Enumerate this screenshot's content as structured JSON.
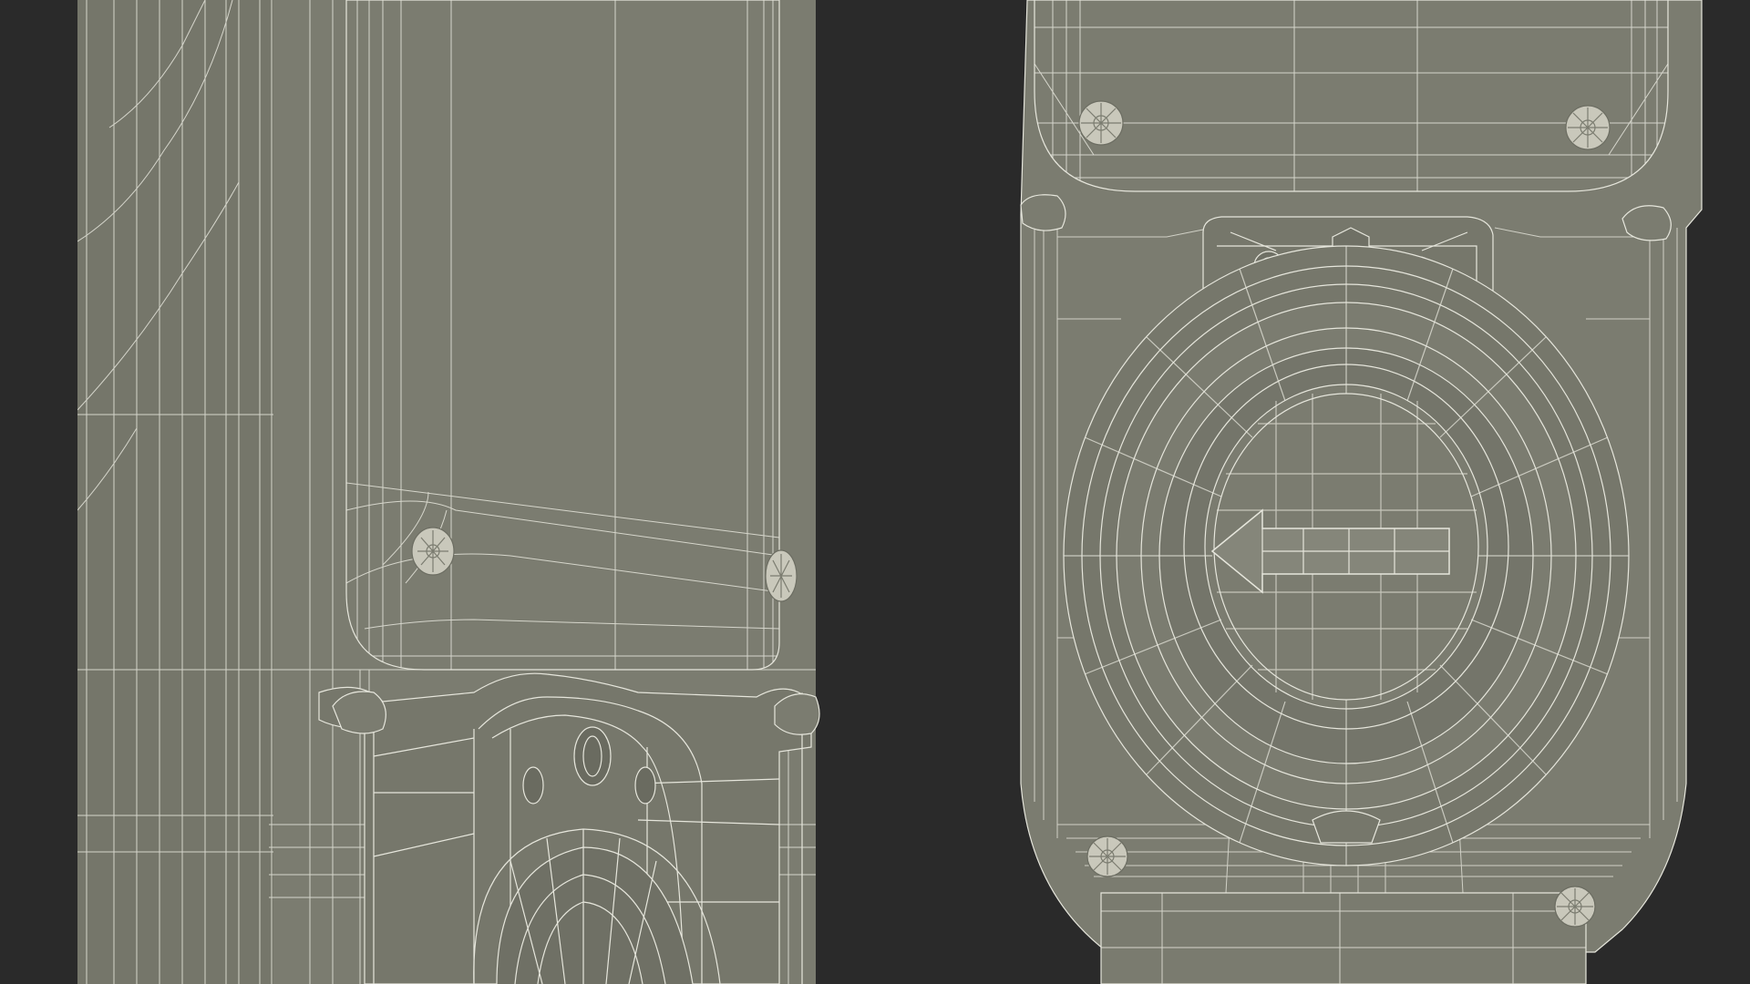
{
  "scene": {
    "subject": "wireframe-3d-render",
    "colors": {
      "background": "#2a2a2a",
      "surface": "#7b7c70",
      "surface_dark": "#6c6d62",
      "surface_light": "#85867a",
      "wire": "#e6e6dc",
      "screw": "#c9c8bb"
    },
    "icons": [
      "screw-icon"
    ]
  }
}
